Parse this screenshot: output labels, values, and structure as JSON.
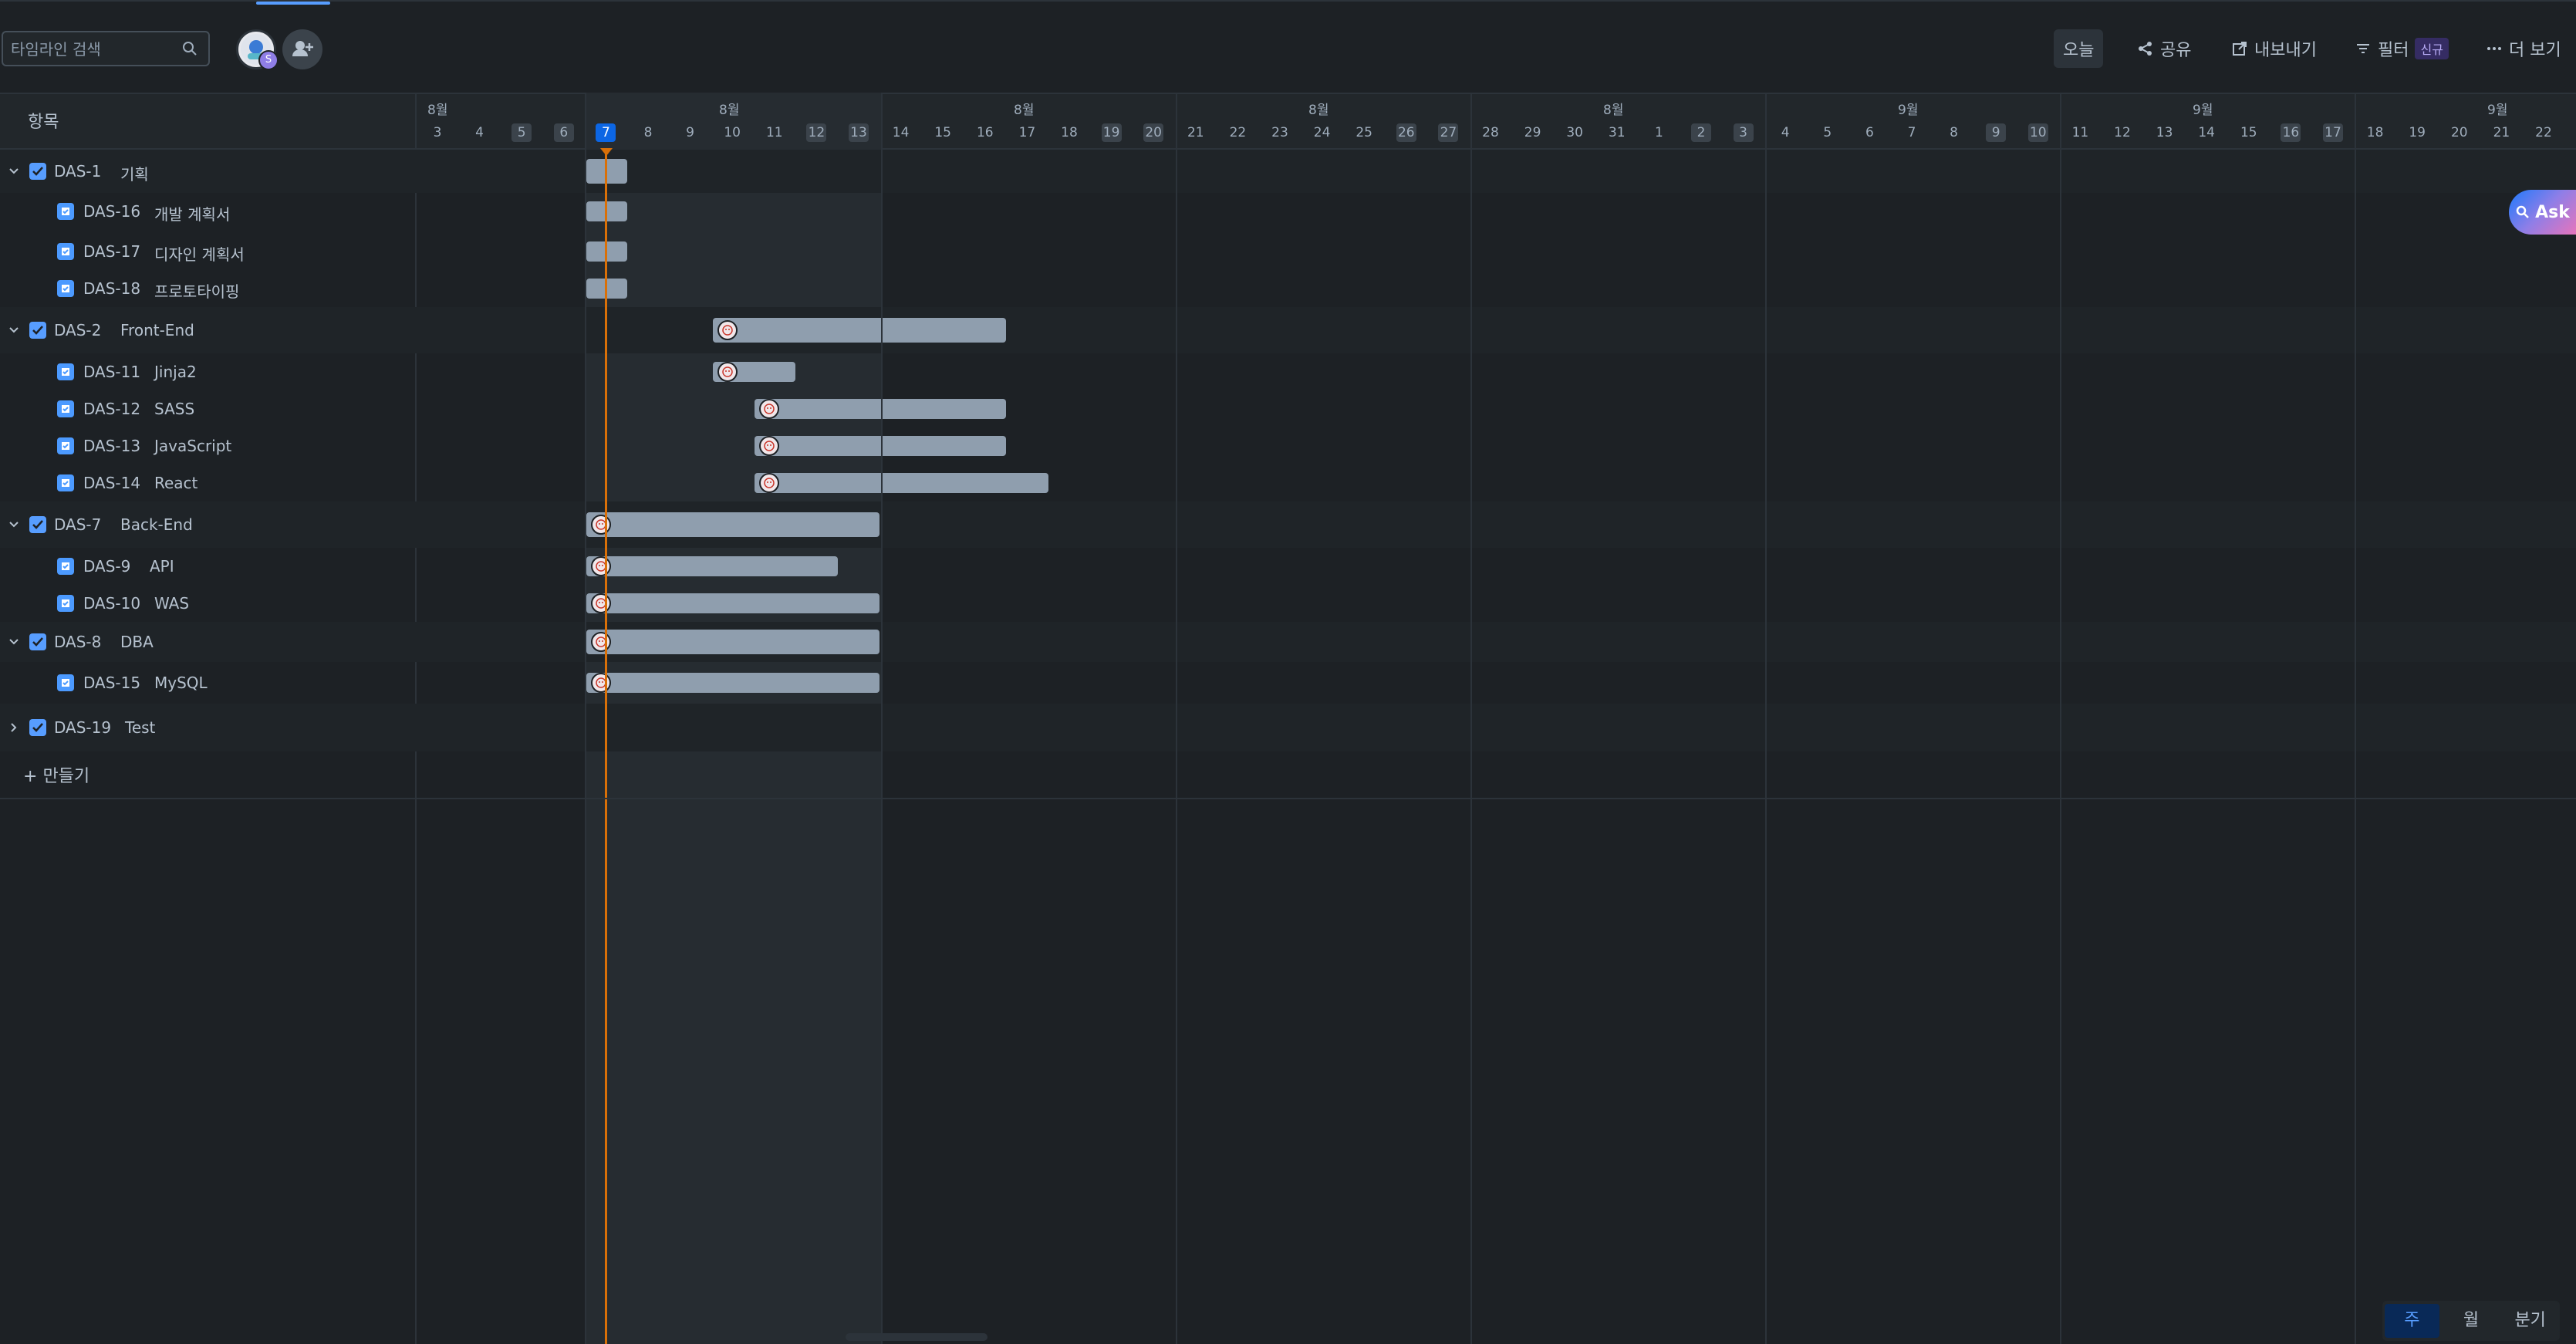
{
  "toolbar": {
    "search_placeholder": "타임라인 검색",
    "avatar_badge": "S",
    "today_label": "오늘",
    "share_label": "공유",
    "export_label": "내보내기",
    "filter_label": "필터",
    "filter_badge": "신규",
    "more_label": "더 보기"
  },
  "list_header": "항목",
  "months": [
    "8월",
    "8월",
    "8월",
    "8월",
    "8월",
    "9월",
    "9월",
    "9월"
  ],
  "days": [
    "3",
    "4",
    "5",
    "6",
    "7",
    "8",
    "9",
    "10",
    "11",
    "12",
    "13",
    "14",
    "15",
    "16",
    "17",
    "18",
    "19",
    "20",
    "21",
    "22",
    "23",
    "24",
    "25",
    "26",
    "27",
    "28",
    "29",
    "30",
    "31",
    "1",
    "2",
    "3",
    "4",
    "5",
    "6",
    "7",
    "8",
    "9",
    "10",
    "11",
    "12",
    "13",
    "14",
    "15",
    "16",
    "17",
    "18",
    "19",
    "20",
    "21",
    "22"
  ],
  "today_day": "7",
  "rows": [
    {
      "key": "DAS-1",
      "name": "기획",
      "type": "epic",
      "expanded": true,
      "bar_start_day": 0,
      "bar_days": 1,
      "avatar": false
    },
    {
      "key": "DAS-16",
      "name": "개발 계획서",
      "type": "task",
      "bar_start_day": 0,
      "bar_days": 1,
      "avatar": false
    },
    {
      "key": "DAS-17",
      "name": "디자인 계획서",
      "type": "task",
      "bar_start_day": 0,
      "bar_days": 1,
      "avatar": false
    },
    {
      "key": "DAS-18",
      "name": "프로토타이핑",
      "type": "task",
      "bar_start_day": 0,
      "bar_days": 1,
      "avatar": false
    },
    {
      "key": "DAS-2",
      "name": "Front-End",
      "type": "epic",
      "expanded": true,
      "bar_start_day": 3,
      "bar_days": 7,
      "avatar": true
    },
    {
      "key": "DAS-11",
      "name": "Jinja2",
      "type": "task",
      "bar_start_day": 3,
      "bar_days": 2,
      "avatar": true
    },
    {
      "key": "DAS-12",
      "name": "SASS",
      "type": "task",
      "bar_start_day": 4,
      "bar_days": 6,
      "avatar": true
    },
    {
      "key": "DAS-13",
      "name": "JavaScript",
      "type": "task",
      "bar_start_day": 4,
      "bar_days": 6,
      "avatar": true
    },
    {
      "key": "DAS-14",
      "name": "React",
      "type": "task",
      "bar_start_day": 4,
      "bar_days": 7,
      "avatar": true
    },
    {
      "key": "DAS-7",
      "name": "Back-End",
      "type": "epic",
      "expanded": true,
      "bar_start_day": 0,
      "bar_days": 7,
      "avatar": true
    },
    {
      "key": "DAS-9",
      "name": "API",
      "type": "task",
      "bar_start_day": 0,
      "bar_days": 6,
      "avatar": true
    },
    {
      "key": "DAS-10",
      "name": "WAS",
      "type": "task",
      "bar_start_day": 0,
      "bar_days": 7,
      "avatar": true
    },
    {
      "key": "DAS-8",
      "name": "DBA",
      "type": "epic",
      "expanded": true,
      "bar_start_day": 0,
      "bar_days": 7,
      "avatar": true
    },
    {
      "key": "DAS-15",
      "name": "MySQL",
      "type": "task",
      "bar_start_day": 0,
      "bar_days": 7,
      "avatar": true
    },
    {
      "key": "DAS-19",
      "name": "Test",
      "type": "epic",
      "expanded": false,
      "bar_start_day": null,
      "bar_days": 0,
      "avatar": false
    }
  ],
  "create_label": "만들기",
  "ask_label": "Ask",
  "scale_options": [
    "주",
    "월",
    "분기"
  ],
  "scale_active": "주",
  "colors": {
    "accent": "#579dff",
    "today_line": "#d97008",
    "bar": "#8f9eae",
    "background": "#1d2125"
  }
}
